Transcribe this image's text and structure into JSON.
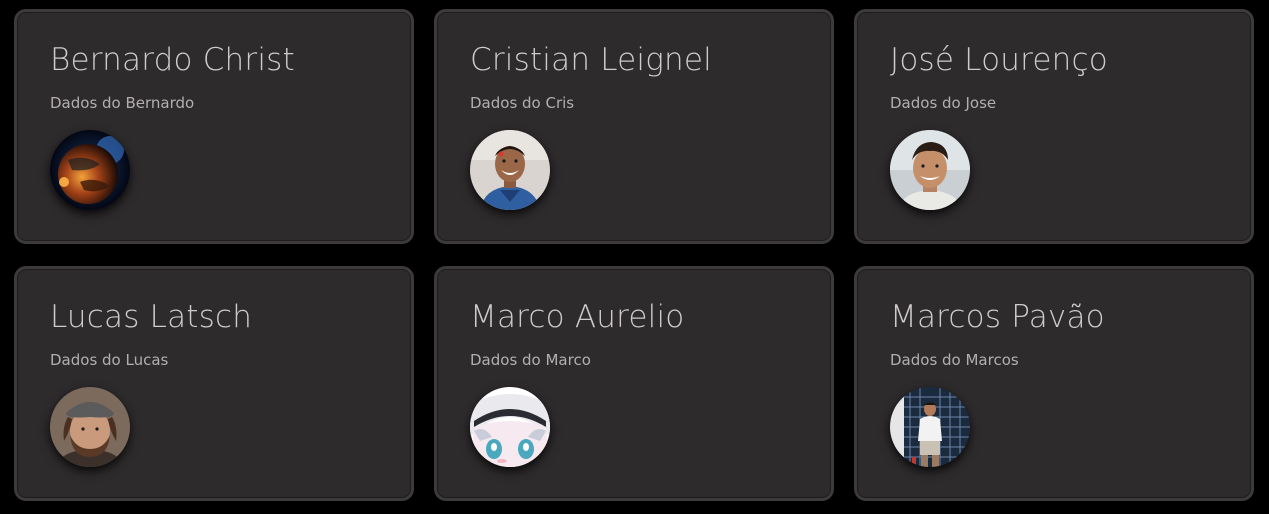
{
  "cards": [
    {
      "name": "Bernardo Christ",
      "subtitle": "Dados do Bernardo",
      "avatar": "planet-avatar"
    },
    {
      "name": "Cristian Leignel",
      "subtitle": "Dados do Cris",
      "avatar": "smiling-man-avatar"
    },
    {
      "name": "José Lourenço",
      "subtitle": "Dados do Jose",
      "avatar": "man-selfie-avatar"
    },
    {
      "name": "Lucas Latsch",
      "subtitle": "Dados do Lucas",
      "avatar": "man-cap-avatar"
    },
    {
      "name": "Marco Aurelio",
      "subtitle": "Dados do Marco",
      "avatar": "anime-girl-avatar"
    },
    {
      "name": "Marcos Pavão",
      "subtitle": "Dados do Marcos",
      "avatar": "man-mirror-avatar"
    }
  ],
  "colors": {
    "background": "#000000",
    "card": "#2e2b2d",
    "card_border": "#3d3a3c",
    "name_text": "#cfcbcd",
    "subtitle_text": "#b3afb1"
  }
}
